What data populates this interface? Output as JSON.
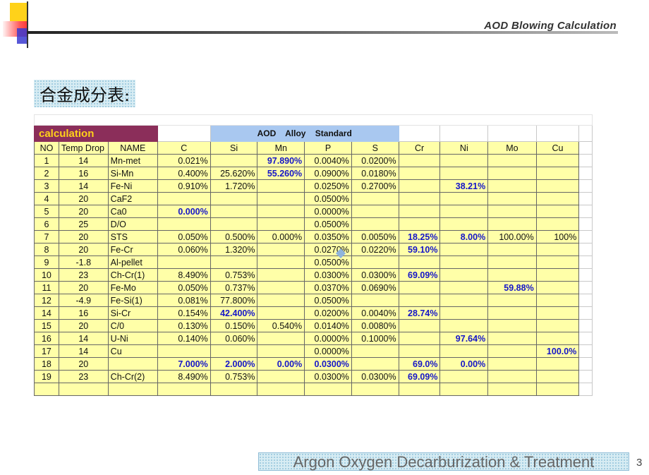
{
  "header": {
    "title": "AOD  Blowing  Calculation"
  },
  "heading": "合金成分表:",
  "sheet": {
    "caption": "calculation",
    "standard_title": "AOD   Alloy   Standard",
    "columns": [
      "NO",
      "Temp Drop",
      "NAME",
      "C",
      "Si",
      "Mn",
      "P",
      "S",
      "Cr",
      "Ni",
      "Mo",
      "Cu"
    ],
    "rows": [
      [
        "1",
        "14",
        "Mn-met",
        "0.021%",
        "",
        "97.890%",
        "0.0040%",
        "0.0200%",
        "",
        "",
        "",
        ""
      ],
      [
        "2",
        "16",
        "Si-Mn",
        "0.400%",
        "25.620%",
        "55.260%",
        "0.0900%",
        "0.0180%",
        "",
        "",
        "",
        ""
      ],
      [
        "3",
        "14",
        "Fe-Ni",
        "0.910%",
        "1.720%",
        "",
        "0.0250%",
        "0.2700%",
        "",
        "38.21%",
        "",
        ""
      ],
      [
        "4",
        "20",
        "CaF2",
        "",
        "",
        "",
        "0.0500%",
        "",
        "",
        "",
        "",
        ""
      ],
      [
        "5",
        "20",
        "Ca0",
        "0.000%",
        "",
        "",
        "0.0000%",
        "",
        "",
        "",
        "",
        ""
      ],
      [
        "6",
        "25",
        "D/O",
        "",
        "",
        "",
        "0.0500%",
        "",
        "",
        "",
        "",
        ""
      ],
      [
        "7",
        "20",
        "STS",
        "0.050%",
        "0.500%",
        "0.000%",
        "0.0350%",
        "0.0050%",
        "18.25%",
        "8.00%",
        "100.00%",
        "100%"
      ],
      [
        "8",
        "20",
        "Fe-Cr",
        "0.060%",
        "1.320%",
        "",
        "0.0270%",
        "0.0220%",
        "59.10%",
        "",
        "",
        ""
      ],
      [
        "9",
        "-1.8",
        "Al-pellet",
        "",
        "",
        "",
        "0.0500%",
        "",
        "",
        "",
        "",
        ""
      ],
      [
        "10",
        "23",
        "Ch-Cr(1)",
        "8.490%",
        "0.753%",
        "",
        "0.0300%",
        "0.0300%",
        "69.09%",
        "",
        "",
        ""
      ],
      [
        "11",
        "20",
        "Fe-Mo",
        "0.050%",
        "0.737%",
        "",
        "0.0370%",
        "0.0690%",
        "",
        "",
        "59.88%",
        ""
      ],
      [
        "12",
        "-4.9",
        "Fe-Si(1)",
        "0.081%",
        "77.800%",
        "",
        "0.0500%",
        "",
        "",
        "",
        "",
        ""
      ],
      [
        "14",
        "16",
        "Si-Cr",
        "0.154%",
        "42.400%",
        "",
        "0.0200%",
        "0.0040%",
        "28.74%",
        "",
        "",
        ""
      ],
      [
        "15",
        "20",
        "C/0",
        "0.130%",
        "0.150%",
        "0.540%",
        "0.0140%",
        "0.0080%",
        "",
        "",
        "",
        ""
      ],
      [
        "16",
        "14",
        "U-Ni",
        "0.140%",
        "0.060%",
        "",
        "0.0000%",
        "0.1000%",
        "",
        "97.64%",
        "",
        ""
      ],
      [
        "17",
        "14",
        "Cu",
        "",
        "",
        "",
        "0.0000%",
        "",
        "",
        "",
        "",
        "100.0%"
      ],
      [
        "18",
        "20",
        "",
        "7.000%",
        "2.000%",
        "0.00%",
        "0.0300%",
        "",
        "69.0%",
        "0.00%",
        "",
        ""
      ],
      [
        "19",
        "23",
        "Ch-Cr(2)",
        "8.490%",
        "0.753%",
        "",
        "0.0300%",
        "0.0300%",
        "69.09%",
        "",
        "",
        ""
      ]
    ],
    "bold_cells": [
      [
        0,
        5
      ],
      [
        1,
        5
      ],
      [
        2,
        9
      ],
      [
        4,
        3
      ],
      [
        6,
        8
      ],
      [
        6,
        9
      ],
      [
        7,
        8
      ],
      [
        9,
        8
      ],
      [
        10,
        10
      ],
      [
        12,
        4
      ],
      [
        12,
        8
      ],
      [
        14,
        9
      ],
      [
        15,
        11
      ],
      [
        16,
        3
      ],
      [
        16,
        4
      ],
      [
        16,
        5
      ],
      [
        16,
        6
      ],
      [
        16,
        8
      ],
      [
        16,
        9
      ],
      [
        17,
        8
      ]
    ]
  },
  "footer": {
    "text": "Argon Oxygen Decarburization &  Treatment",
    "page_number": "3"
  },
  "colors": {
    "cell_fill": "#ffffa8",
    "caption_bg": "#8b2e5a",
    "caption_text": "#ffd21a",
    "standard_bg": "#a9c8f0",
    "bold_value": "#1515c8"
  }
}
